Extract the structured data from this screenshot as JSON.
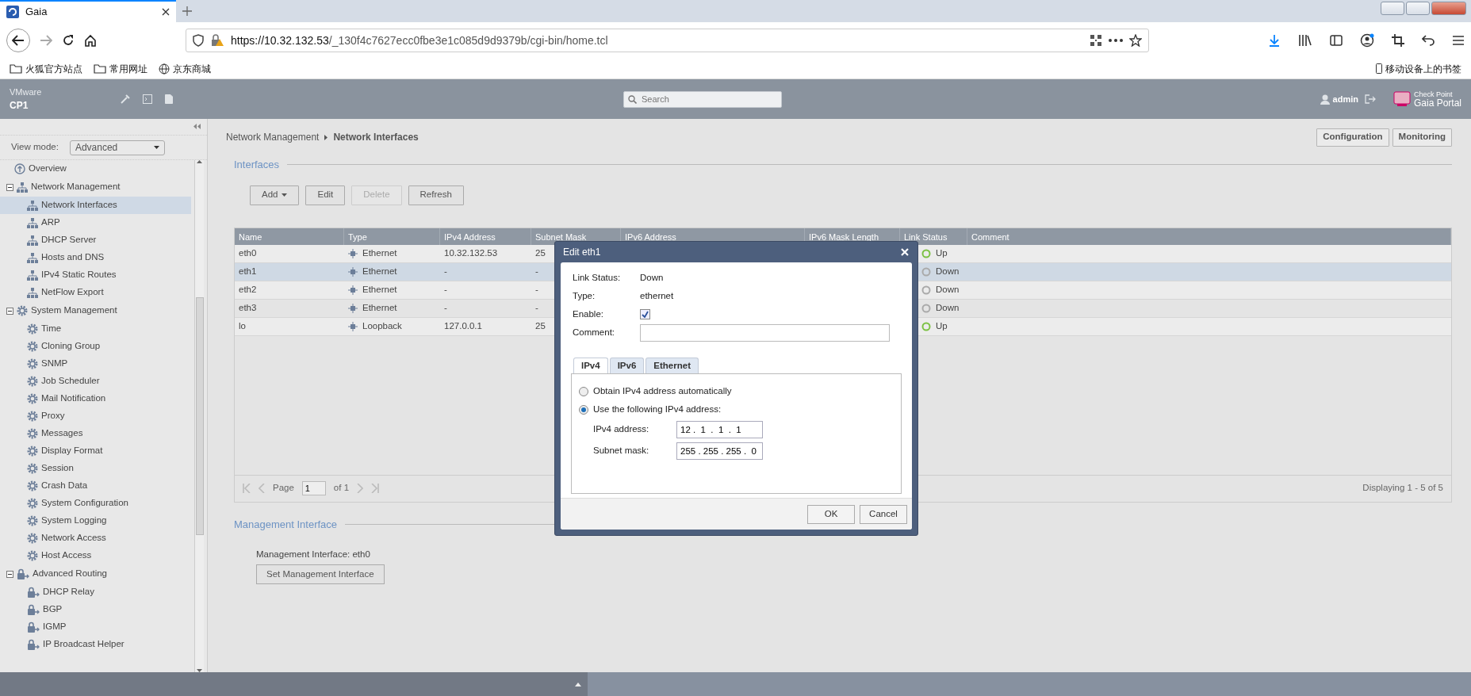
{
  "browser": {
    "tab_title": "Gaia",
    "url_host": "https://10.32.132.53",
    "url_path": "/_130f4c7627ecc0fbe3e1c085d9d9379b/cgi-bin/home.tcl",
    "bookmarks": [
      "火狐官方站点",
      "常用网址",
      "京东商城"
    ],
    "mobile_bookmarks": "移动设备上的书签"
  },
  "header": {
    "vendor": "VMware",
    "host": "CP1",
    "search_placeholder": "Search",
    "user": "admin",
    "logo_line1": "Check Point",
    "logo_line2": "Gaia Portal"
  },
  "sidebar": {
    "view_mode_label": "View mode:",
    "view_mode": "Advanced",
    "items": [
      {
        "label": "Overview",
        "kind": "overview",
        "selected": false
      },
      {
        "label": "Network Management",
        "kind": "network",
        "expanded": true,
        "selected": false,
        "children": [
          {
            "label": "Network Interfaces",
            "selected": true
          },
          {
            "label": "ARP",
            "selected": false
          },
          {
            "label": "DHCP Server",
            "selected": false
          },
          {
            "label": "Hosts and DNS",
            "selected": false
          },
          {
            "label": "IPv4 Static Routes",
            "selected": false
          },
          {
            "label": "NetFlow Export",
            "selected": false
          }
        ]
      },
      {
        "label": "System Management",
        "kind": "system",
        "expanded": true,
        "selected": false,
        "children": [
          {
            "label": "Time",
            "selected": false
          },
          {
            "label": "Cloning Group",
            "selected": false
          },
          {
            "label": "SNMP",
            "selected": false
          },
          {
            "label": "Job Scheduler",
            "selected": false
          },
          {
            "label": "Mail Notification",
            "selected": false
          },
          {
            "label": "Proxy",
            "selected": false
          },
          {
            "label": "Messages",
            "selected": false
          },
          {
            "label": "Display Format",
            "selected": false
          },
          {
            "label": "Session",
            "selected": false
          },
          {
            "label": "Crash Data",
            "selected": false
          },
          {
            "label": "System Configuration",
            "selected": false
          },
          {
            "label": "System Logging",
            "selected": false
          },
          {
            "label": "Network Access",
            "selected": false
          },
          {
            "label": "Host Access",
            "selected": false
          }
        ]
      },
      {
        "label": "Advanced Routing",
        "kind": "routing",
        "expanded": true,
        "selected": false,
        "children": [
          {
            "label": "DHCP Relay",
            "selected": false
          },
          {
            "label": "BGP",
            "selected": false
          },
          {
            "label": "IGMP",
            "selected": false
          },
          {
            "label": "IP Broadcast Helper",
            "selected": false
          }
        ]
      }
    ]
  },
  "breadcrumb": [
    "Network Management",
    "Network Interfaces"
  ],
  "mode_buttons": [
    "Configuration",
    "Monitoring"
  ],
  "interfaces": {
    "title": "Interfaces",
    "toolbar": [
      {
        "label": "Add",
        "kind": "menu",
        "disabled": false
      },
      {
        "label": "Edit",
        "kind": "plain",
        "disabled": false
      },
      {
        "label": "Delete",
        "kind": "plain",
        "disabled": true
      },
      {
        "label": "Refresh",
        "kind": "plain",
        "disabled": false
      }
    ],
    "table": {
      "columns": [
        "Name",
        "Type",
        "IPv4 Address",
        "Subnet Mask",
        "IPv6 Address",
        "IPv6 Mask Length",
        "Link Status",
        "Comment"
      ],
      "rows": [
        {
          "name": "eth0",
          "type": "Ethernet",
          "ipv4": "10.32.132.53",
          "subnet": "25",
          "link_status": "Up",
          "link_up": true,
          "selected": false
        },
        {
          "name": "eth1",
          "type": "Ethernet",
          "ipv4": "-",
          "subnet": "-",
          "link_status": "Down",
          "link_up": false,
          "selected": true
        },
        {
          "name": "eth2",
          "type": "Ethernet",
          "ipv4": "-",
          "subnet": "-",
          "link_status": "Down",
          "link_up": false,
          "selected": false
        },
        {
          "name": "eth3",
          "type": "Ethernet",
          "ipv4": "-",
          "subnet": "-",
          "link_status": "Down",
          "link_up": false,
          "selected": false
        },
        {
          "name": "lo",
          "type": "Loopback",
          "ipv4": "127.0.0.1",
          "subnet": "25",
          "link_status": "Up",
          "link_up": true,
          "selected": false
        }
      ]
    },
    "pager": {
      "page_label": "Page",
      "page": "1",
      "of": "of 1",
      "summary": "Displaying 1 - 5 of 5"
    }
  },
  "management": {
    "title": "Management Interface",
    "text": "Management Interface: eth0",
    "button": "Set Management Interface"
  },
  "dialog": {
    "title": "Edit eth1",
    "fields": [
      {
        "label": "Link Status:",
        "value": "Down"
      },
      {
        "label": "Type:",
        "value": "ethernet"
      }
    ],
    "enable_label": "Enable:",
    "enabled": true,
    "comment_label": "Comment:",
    "tabs": [
      {
        "label": "IPv4",
        "selected": true
      },
      {
        "label": "IPv6",
        "selected": false
      },
      {
        "label": "Ethernet",
        "selected": false
      }
    ],
    "options": [
      {
        "label": "Obtain IPv4 address automatically",
        "selected": false
      },
      {
        "label": "Use the following IPv4 address:",
        "selected": true
      }
    ],
    "ipv4_label": "IPv4 address:",
    "ipv4": "12 .  1  .  1  .  1",
    "mask_label": "Subnet mask:",
    "mask": "255 . 255 . 255 .  0",
    "buttons": [
      "OK",
      "Cancel"
    ]
  }
}
